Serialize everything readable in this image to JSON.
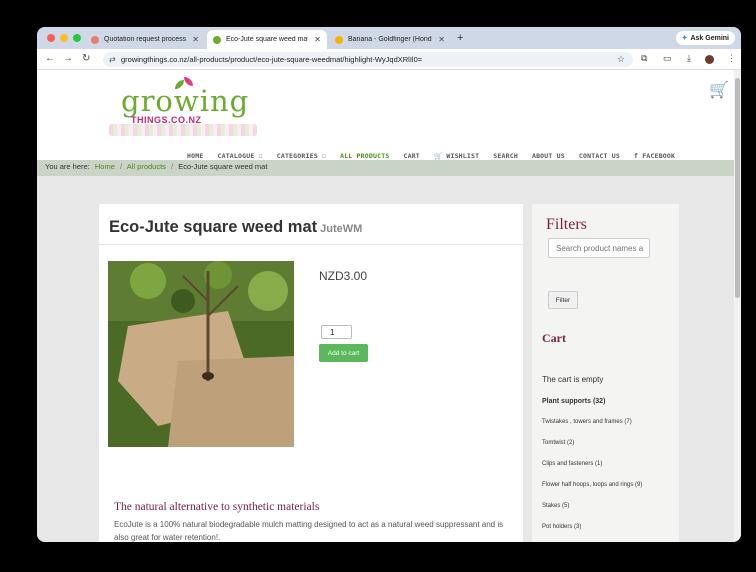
{
  "browser": {
    "tabs": [
      {
        "title": "Quotation request process o",
        "favicon_color": "#e67c73",
        "active": false
      },
      {
        "title": "Eco-Jute square weed mat",
        "favicon_color": "#6cab2e",
        "active": true
      },
      {
        "title": "Banana - Goldfinger (Hondu",
        "favicon_color": "#f4b400",
        "active": false
      }
    ],
    "new_tab": "+",
    "gemini_label": "Ask Gemini",
    "url": "growingthings.co.nz/all-products/product/eco-jute-square-weedmat/highlight-WyJqdXRlIl0="
  },
  "site": {
    "logo_word": "growing",
    "logo_sub": "THINGS.CO.NZ",
    "menu": [
      {
        "label": "HOME",
        "active": false
      },
      {
        "label": "CATALOGUE ☐",
        "active": false
      },
      {
        "label": "CATEGORIES ☐",
        "active": false
      },
      {
        "label": "ALL PRODUCTS",
        "active": true
      },
      {
        "label": "CART",
        "active": false
      },
      {
        "label": "🛒 WISHLIST",
        "active": false
      },
      {
        "label": "SEARCH",
        "active": false
      },
      {
        "label": "ABOUT US",
        "active": false
      },
      {
        "label": "CONTACT US",
        "active": false
      },
      {
        "label": "f FACEBOOK",
        "active": false
      }
    ],
    "breadcrumb": {
      "prefix": "You are here:",
      "items": [
        "Home",
        "All products"
      ],
      "current": "Eco-Jute square weed mat"
    }
  },
  "product": {
    "title": "Eco-Jute square weed mat",
    "sku": "JuteWM",
    "price": "NZD3.00",
    "quantity": "1",
    "add_to_cart": "Add to cart",
    "subheading": "The natural alternative to synthetic materials",
    "description": "EcoJute is a 100% natural biodegradable mulch matting designed to act as a natural weed suppressant and is also great for water retention!."
  },
  "sidebar": {
    "filters_title": "Filters",
    "search_placeholder": "Search product names a",
    "filter_button": "Filter",
    "cart_title": "Cart",
    "cart_empty": "The cart is empty",
    "categories": [
      {
        "label": "Plant supports (32)",
        "top": true
      },
      {
        "label": "Twistakes , towers and frames (7)",
        "top": false
      },
      {
        "label": "Tomtwist (2)",
        "top": false
      },
      {
        "label": "Clips and fasteners (1)",
        "top": false
      },
      {
        "label": "Flower half hoops, loops and rings (9)",
        "top": false
      },
      {
        "label": "Stakes (5)",
        "top": false
      },
      {
        "label": "Pot holders (3)",
        "top": false
      }
    ]
  },
  "colors": {
    "brand_green": "#6cab2e",
    "brand_maroon": "#7c1f3f",
    "button_green": "#5cb85c"
  }
}
